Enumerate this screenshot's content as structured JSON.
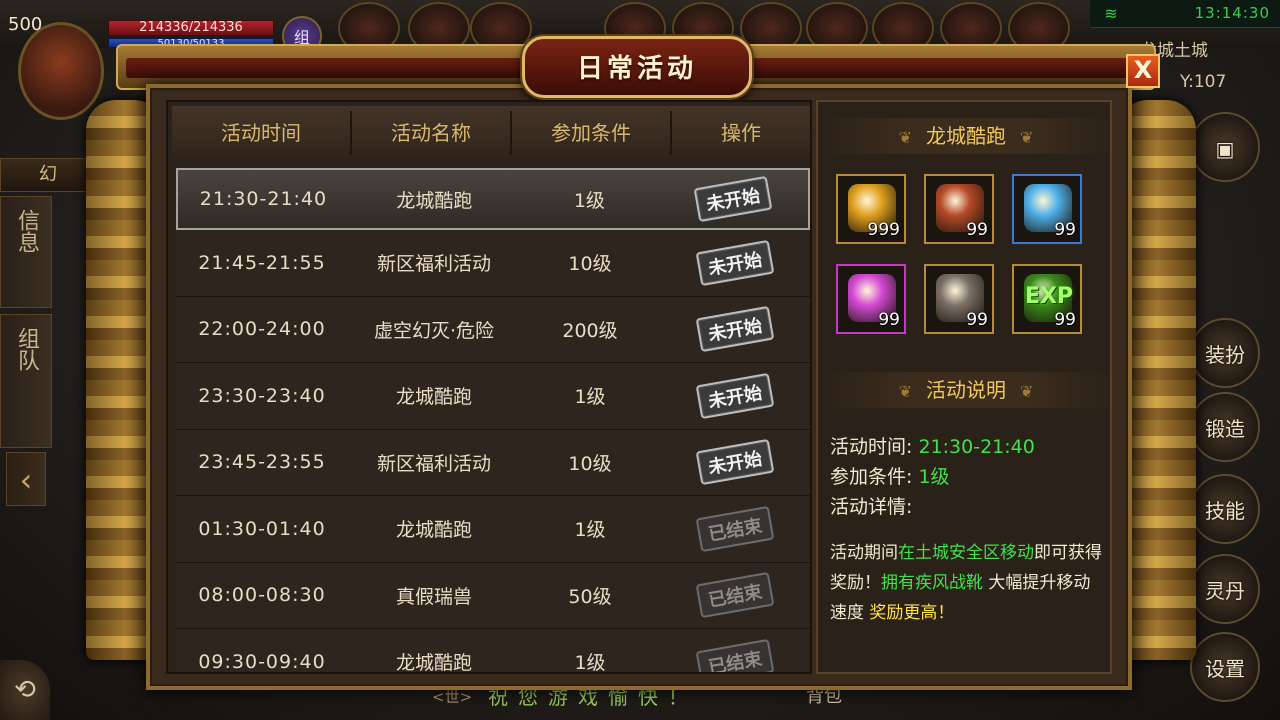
{
  "hud": {
    "level": "500",
    "hp": "214336/214336",
    "mp": "50130/50133",
    "group": "组",
    "clock": "13:14:30",
    "map_name": "龙城土城",
    "coord": "Y:107"
  },
  "left_tabs": {
    "top": "幻",
    "info": "信息",
    "team": "组队"
  },
  "right_buttons": [
    "装扮",
    "锻造",
    "技能",
    "灵丹",
    "设置"
  ],
  "bottom": {
    "world": "世",
    "greeting": "祝您游戏愉快！",
    "bag": "背包"
  },
  "dialog": {
    "title": "日常活动",
    "close": "X",
    "columns": [
      "活动时间",
      "活动名称",
      "参加条件",
      "操作"
    ],
    "rows": [
      {
        "time": "21:30-21:40",
        "name": "龙城酷跑",
        "req": "1级",
        "status": "未开始",
        "state": "pending",
        "selected": true
      },
      {
        "time": "21:45-21:55",
        "name": "新区福利活动",
        "req": "10级",
        "status": "未开始",
        "state": "pending"
      },
      {
        "time": "22:00-24:00",
        "name": "虚空幻灭·危险",
        "req": "200级",
        "status": "未开始",
        "state": "pending"
      },
      {
        "time": "23:30-23:40",
        "name": "龙城酷跑",
        "req": "1级",
        "status": "未开始",
        "state": "pending"
      },
      {
        "time": "23:45-23:55",
        "name": "新区福利活动",
        "req": "10级",
        "status": "未开始",
        "state": "pending"
      },
      {
        "time": "01:30-01:40",
        "name": "龙城酷跑",
        "req": "1级",
        "status": "已结束",
        "state": "ended"
      },
      {
        "time": "08:00-08:30",
        "name": "真假瑞兽",
        "req": "50级",
        "status": "已结束",
        "state": "ended"
      },
      {
        "time": "09:30-09:40",
        "name": "龙城酷跑",
        "req": "1级",
        "status": "已结束",
        "state": "ended"
      }
    ]
  },
  "detail": {
    "activity_title": "龙城酷跑",
    "rewards": [
      {
        "icon": "gold-ingot-icon",
        "qty": "999",
        "color": "#e0a020"
      },
      {
        "icon": "dragon-relic-icon",
        "qty": "99",
        "color": "#b54a28"
      },
      {
        "icon": "crystal-blade-icon",
        "qty": "99",
        "color": "#4fb0e8"
      },
      {
        "icon": "rainbow-gem-icon",
        "qty": "99",
        "color": "#d54ad5"
      },
      {
        "icon": "iron-ore-icon",
        "qty": "99",
        "color": "#7a7068"
      },
      {
        "icon": "exp-icon",
        "qty": "99",
        "label": "EXP",
        "color": "#3a8a1c"
      }
    ],
    "desc_title": "活动说明",
    "time_label": "活动时间:",
    "time_value": "21:30-21:40",
    "req_label": "参加条件:",
    "req_value": "1级",
    "detail_label": "活动详情:",
    "desc_parts": [
      "活动期间",
      "在土城安全区移动",
      "即可获得奖励！",
      "拥有疾风战靴",
      "大幅提升移动速度",
      "奖励更高！"
    ]
  }
}
